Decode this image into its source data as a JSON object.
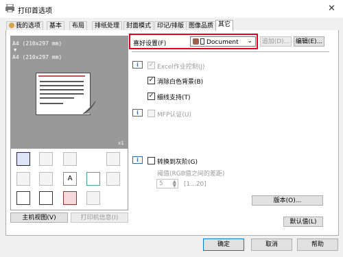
{
  "window": {
    "title": "打印首选项",
    "close_glyph": "✕"
  },
  "tabs": [
    {
      "label": "我的选项"
    },
    {
      "label": "基本"
    },
    {
      "label": "布局"
    },
    {
      "label": "排纸处理"
    },
    {
      "label": "封面模式"
    },
    {
      "label": "印记/排版"
    },
    {
      "label": "图像品质"
    },
    {
      "label": "其它",
      "active": true
    }
  ],
  "preview": {
    "paper_line1": "A4 (210x297 mm)",
    "arrow": "▼",
    "paper_line2": "A4 (210x297 mm)",
    "copies": "x1",
    "icons": [
      "printer-blue-icon",
      "booklet-icon",
      "pages-icon",
      "tray-icon",
      "copy-icon",
      "stack-icon",
      "font-icon",
      "doc-icon",
      "watermark-icon",
      "printer-doc-icon",
      "user-icon",
      "user-card-icon",
      "folder-icon"
    ]
  },
  "left_buttons": {
    "main_view": "主机视图(V)",
    "printer_info": "打印机信息(I)"
  },
  "favorite": {
    "label": "喜好设置(F)",
    "value": "Document",
    "add_button": "追加(D)...",
    "edit_button": "编辑(E)..."
  },
  "options": {
    "excel_control": "Excel作业控制(J)",
    "remove_white_bg": "消除白色背景(B)",
    "thin_line_support": "细线支持(T)",
    "mfp_auth": "MFP认证(U)",
    "convert_gray": "转换到灰阶(G)",
    "threshold_label": "阈值(RGB值之间的差距)",
    "threshold_value": "5",
    "threshold_range": "[1...20]",
    "check_mark": "✓"
  },
  "version_button": "版本(O)...",
  "default_button": "默认值(L)",
  "footer": {
    "ok": "确定",
    "cancel": "取消",
    "help": "帮助"
  }
}
